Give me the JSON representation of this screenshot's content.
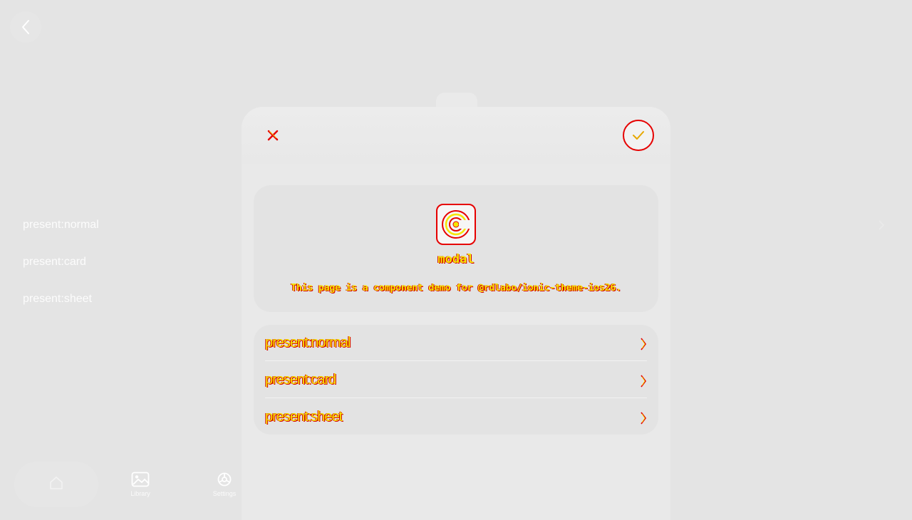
{
  "background": {
    "list": [
      {
        "label": "present:normal"
      },
      {
        "label": "present:card"
      },
      {
        "label": "present:sheet"
      }
    ],
    "tabs": [
      {
        "label": "",
        "icon": "home-icon",
        "active": true
      },
      {
        "label": "Library",
        "icon": "image-icon"
      },
      {
        "label": "Settings",
        "icon": "gear-icon"
      }
    ]
  },
  "modal": {
    "close_icon": "close-icon",
    "confirm_icon": "checkmark-icon",
    "intro": {
      "icon": "app-logo-icon",
      "title": "modal",
      "description": "This page is a component demo for @rdlabo/ionic-theme-ios26."
    },
    "items": [
      {
        "label": "present:normal"
      },
      {
        "label": "present:card"
      },
      {
        "label": "present:sheet"
      }
    ]
  },
  "colors": {
    "accent_red": "#e60000",
    "accent_yellow": "#f5e600",
    "page_bg": "#e4e4e4"
  }
}
